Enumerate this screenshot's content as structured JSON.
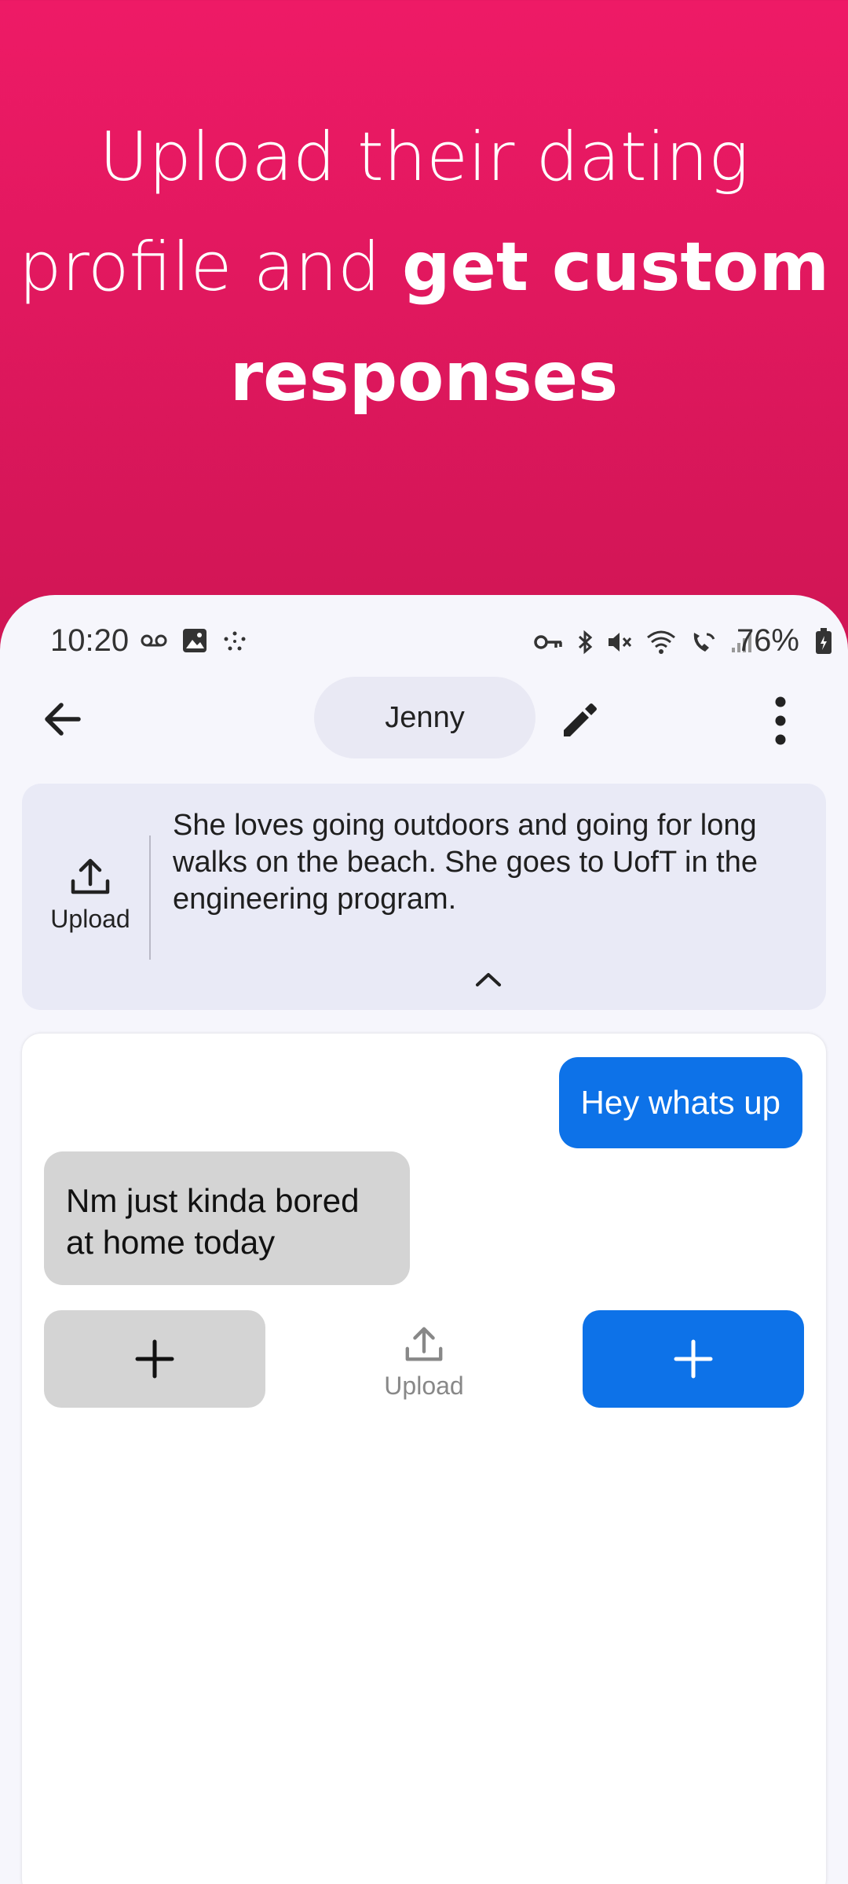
{
  "hero": {
    "line1": "Upload their dating",
    "line2_regular": "profile and ",
    "line2_bold": "get custom",
    "line3_bold": "responses"
  },
  "status_bar": {
    "time": "10:20",
    "battery": "76%",
    "left_icons": [
      "voicemail-icon",
      "image-icon",
      "sparkle-icon"
    ],
    "right_icons": [
      "vpn-key-icon",
      "bluetooth-icon",
      "mute-icon",
      "wifi-icon",
      "wifi-calling-icon",
      "signal-icon",
      "battery-icon"
    ]
  },
  "header": {
    "contact_name": "Jenny"
  },
  "profile": {
    "upload_label": "Upload",
    "description": "She loves going outdoors and going for long walks on the beach. She goes to UofT in the engineering program."
  },
  "chat": {
    "messages": [
      {
        "side": "out",
        "text": "Hey whats up"
      },
      {
        "side": "in",
        "text": "Nm just kinda bored at home today"
      }
    ],
    "upload_label": "Upload"
  },
  "colors": {
    "brand": "#e91962",
    "accent_blue": "#0d72e8",
    "bubble_gray": "#d4d4d4"
  }
}
